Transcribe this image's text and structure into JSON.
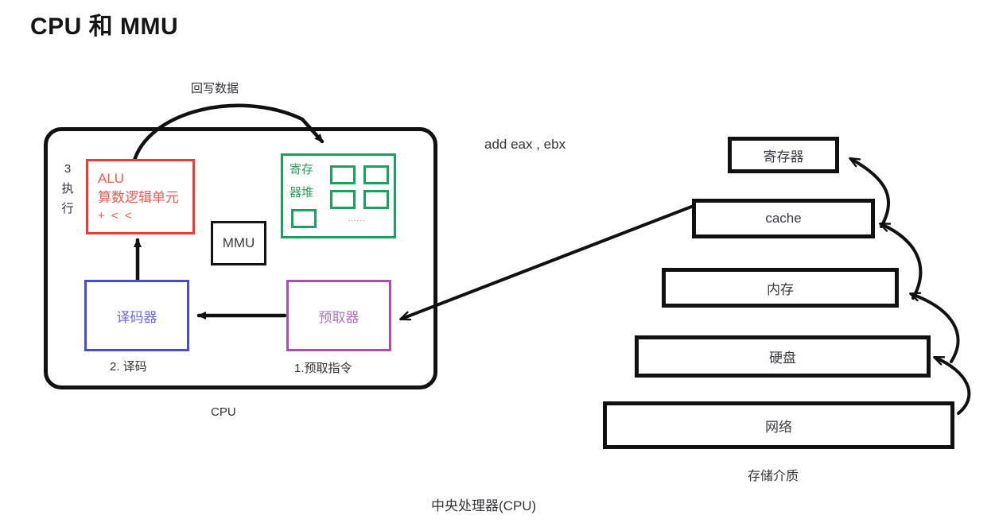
{
  "page": {
    "title": "CPU 和 MMU",
    "bottom_caption": "中央处理器(CPU)"
  },
  "cpu": {
    "outer_caption": "CPU",
    "writeback_label": "回写数据",
    "instruction": "add eax , ebx",
    "stage3": {
      "number": "3",
      "line2": "执",
      "line3": "行"
    },
    "alu": {
      "title": "ALU",
      "subtitle": "算数逻辑单元",
      "ops": "+  < <"
    },
    "mmu": {
      "label": "MMU"
    },
    "register_file": {
      "label_line1": "寄存",
      "label_line2": "器堆",
      "dots": "......",
      "cell_count": 5
    },
    "decoder": {
      "label": "译码器",
      "caption": "2. 译码"
    },
    "prefetcher": {
      "label": "预取器",
      "caption": "1.预取指令"
    }
  },
  "memory_hierarchy": {
    "caption": "存储介质",
    "levels": [
      {
        "label": "寄存器"
      },
      {
        "label": "cache"
      },
      {
        "label": "内存"
      },
      {
        "label": "硬盘"
      },
      {
        "label": "网络"
      }
    ]
  },
  "colors": {
    "alu": "#ef3b36",
    "register_file": "#17a15a",
    "decoder": "#4a4ad4",
    "prefetcher": "#ab4fab",
    "outline": "#111111",
    "text": "#3a3a44"
  }
}
